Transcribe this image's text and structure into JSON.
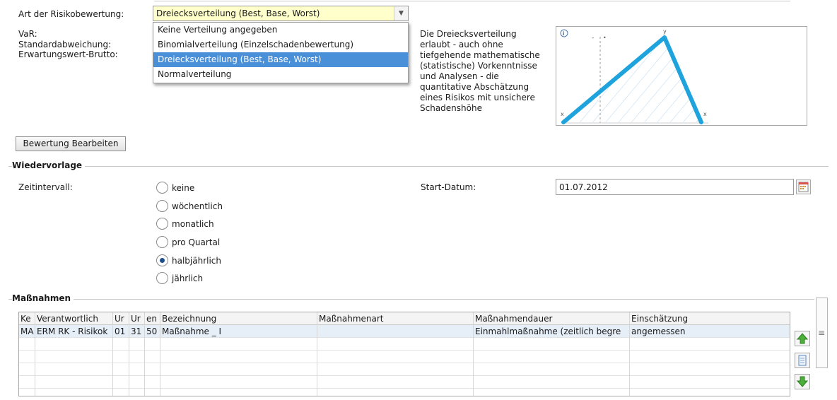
{
  "risk": {
    "type_label": "Art der Risikobewertung:",
    "selected": "Dreiecksverteilung (Best, Base, Worst)",
    "options": [
      "Keine Verteilung angegeben",
      "Binomialverteilung (Einzelschadenbewertung)",
      "Dreiecksverteilung (Best, Base, Worst)",
      "Normalverteilung"
    ],
    "var_label": "VaR:",
    "std_label": "Standardabweichung:",
    "ev_label": "Erwartungswert-Brutto:",
    "description": "Die Dreiecksverteilung\nerlaubt - auch ohne\ntiefgehende mathematische\n(statistische) Vorkenntnisse\nund Analysen - die\nquantitative Abschätzung\neines Risikos mit unsichere\nSchadenshöhe",
    "edit_button": "Bewertung Bearbeiten",
    "chart_markers": {
      "top": "y",
      "left": "x",
      "right": "x",
      "dash": "-",
      "dot": "•"
    },
    "accent_color": "#1ea3dc"
  },
  "wiedervorlage": {
    "title": "Wiedervorlage",
    "interval_label": "Zeitintervall:",
    "options": [
      "keine",
      "wöchentlich",
      "monatlich",
      "pro Quartal",
      "halbjährlich",
      "jährlich"
    ],
    "selected_index": 4,
    "start_label": "Start-Datum:",
    "start_value": "01.07.2012"
  },
  "massnahmen": {
    "title": "Maßnahmen",
    "columns": [
      "Ke",
      "Verantwortlich",
      "Ur",
      "Ur",
      "en",
      "Bezeichnung",
      "Maßnahmenart",
      "Maßnahmendauer",
      "Einschätzung"
    ],
    "rows": [
      [
        "MA",
        "ERM RK - Risikok",
        "01",
        "31",
        "50",
        "Maßnahme _ I",
        "",
        "Einmahlmaßnahme (zeitlich begre",
        "angemessen"
      ]
    ],
    "grip": "≡"
  }
}
